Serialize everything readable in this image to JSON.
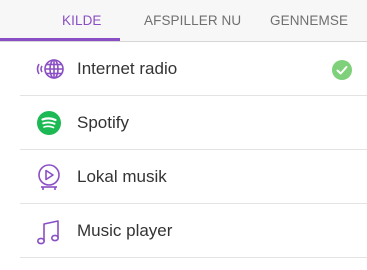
{
  "tabs": [
    {
      "label": "KILDE",
      "active": true
    },
    {
      "label": "AFSPILLER NU",
      "active": false
    },
    {
      "label": "GENNEMSE",
      "active": false
    }
  ],
  "sources": [
    {
      "label": "Internet radio",
      "icon": "internet-radio-icon",
      "selected": true
    },
    {
      "label": "Spotify",
      "icon": "spotify-icon",
      "selected": false
    },
    {
      "label": "Lokal musik",
      "icon": "local-music-icon",
      "selected": false
    },
    {
      "label": "Music player",
      "icon": "music-note-icon",
      "selected": false
    }
  ],
  "colors": {
    "accent": "#8a4fc4",
    "check": "#7ed07a",
    "spotify": "#1db954",
    "icon": "#8a4fc4"
  }
}
